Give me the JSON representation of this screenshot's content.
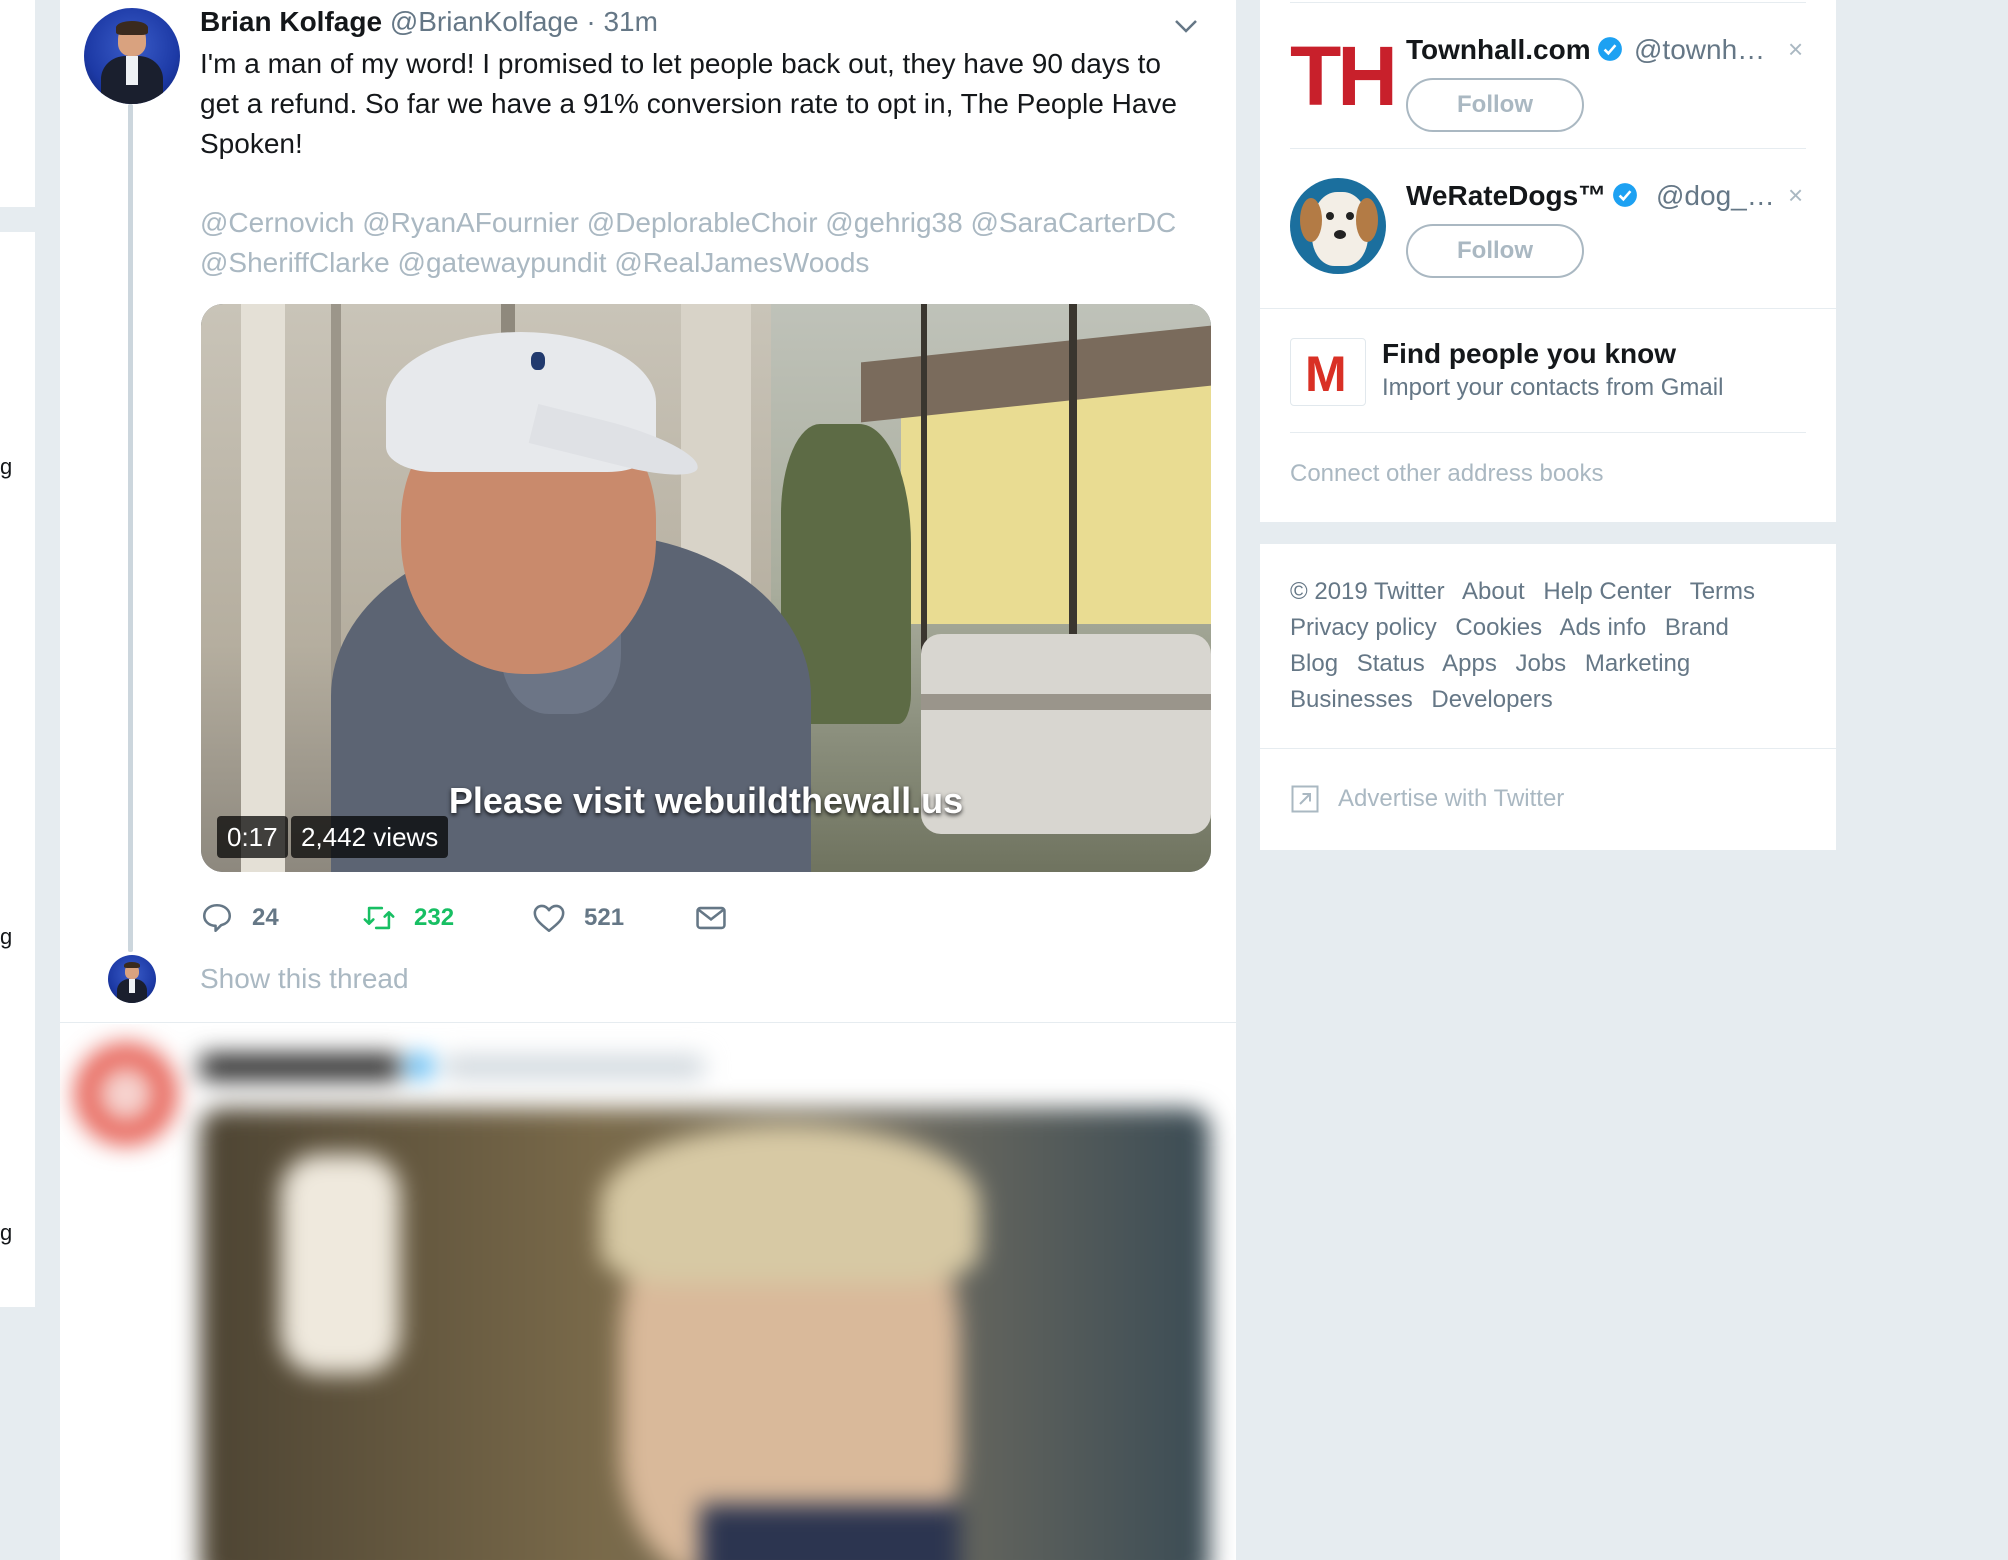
{
  "colors": {
    "background": "#e6ecf0",
    "card": "#ffffff",
    "text_primary": "#14171a",
    "text_secondary": "#657786",
    "text_muted": "#aab8c2",
    "retweet_active": "#17bf63",
    "verified": "#1da1f2",
    "townhall_red": "#c8202b",
    "gmail_red": "#d93025"
  },
  "tweet": {
    "author_name": "Brian Kolfage",
    "author_handle": "@BrianKolfage",
    "time": "· 31m",
    "text": "I'm a man of my word! I promised to let people back out,  they have 90 days to get a refund. So far we have a 91% conversion rate to opt in, The People Have Spoken!",
    "mentions": "@Cernovich @RyanAFournier @DeplorableChoir @gehrig38 @SaraCarterDC @SheriffClarke @gatewaypundit @RealJamesWoods",
    "media": {
      "caption": "Please visit webuildthewall.us",
      "duration": "0:17",
      "views": "2,442 views"
    },
    "actions": {
      "reply_count": "24",
      "retweet_count": "232",
      "like_count": "521"
    },
    "show_thread": "Show this thread",
    "icons": [
      "chevron-down-icon",
      "reply-icon",
      "retweet-icon",
      "like-icon",
      "message-icon"
    ]
  },
  "who_to_follow": [
    {
      "name": "Townhall.com",
      "handle": "@townh…",
      "follow_label": "Follow",
      "avatar_text": "TH",
      "dismiss": "×"
    },
    {
      "name": "WeRateDogs™",
      "handle": "@dog_…",
      "follow_label": "Follow",
      "dismiss": "×"
    }
  ],
  "find_people": {
    "title": "Find people you know",
    "subtitle": "Import your contacts from Gmail",
    "logo_text": "M",
    "connect_other": "Connect other address books"
  },
  "footer": {
    "links": [
      "© 2019 Twitter",
      "About",
      "Help Center",
      "Terms",
      "Privacy policy",
      "Cookies",
      "Ads info",
      "Brand",
      "Blog",
      "Status",
      "Apps",
      "Jobs",
      "Marketing",
      "Businesses",
      "Developers"
    ],
    "advertise": "Advertise with Twitter"
  }
}
